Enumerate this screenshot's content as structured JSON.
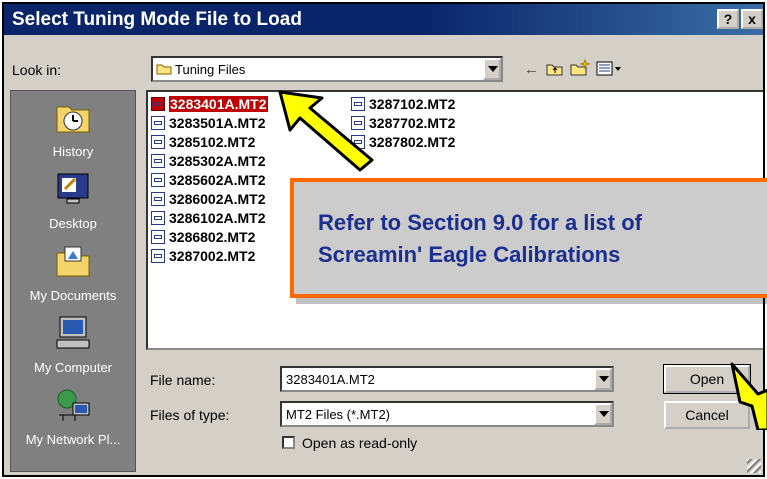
{
  "window": {
    "title": "Select Tuning Mode File to Load",
    "help_btn": "?",
    "close_btn": "x"
  },
  "lookin": {
    "label": "Look in:",
    "value": "Tuning Files"
  },
  "places": [
    {
      "label": "History",
      "icon": "history-icon"
    },
    {
      "label": "Desktop",
      "icon": "desktop-icon"
    },
    {
      "label": "My Documents",
      "icon": "my-documents-icon"
    },
    {
      "label": "My Computer",
      "icon": "my-computer-icon"
    },
    {
      "label": "My Network Pl...",
      "icon": "network-icon"
    }
  ],
  "files": {
    "col1": [
      "3283401A.MT2",
      "3283501A.MT2",
      "3285102.MT2",
      "3285302A.MT2",
      "3285602A.MT2",
      "3286002A.MT2",
      "3286102A.MT2",
      "3286802.MT2",
      "3287002.MT2"
    ],
    "col2": [
      "3287102.MT2",
      "3287702.MT2",
      "3287802.MT2"
    ],
    "selected": "3283401A.MT2"
  },
  "filename": {
    "label": "File name:",
    "value": "3283401A.MT2"
  },
  "filetype": {
    "label": "Files of type:",
    "value": "MT2 Files (*.MT2)"
  },
  "readonly_label": "Open as read-only",
  "buttons": {
    "open": "Open",
    "cancel": "Cancel"
  },
  "callout": {
    "line1": "Refer to Section 9.0 for a list of",
    "line2": "Screamin' Eagle Calibrations"
  },
  "colors": {
    "title_bar": "#0a246a",
    "selection": "#c00000",
    "callout_border": "#ff6a00",
    "callout_text": "#1a2f8f",
    "arrow": "#ffff00"
  }
}
